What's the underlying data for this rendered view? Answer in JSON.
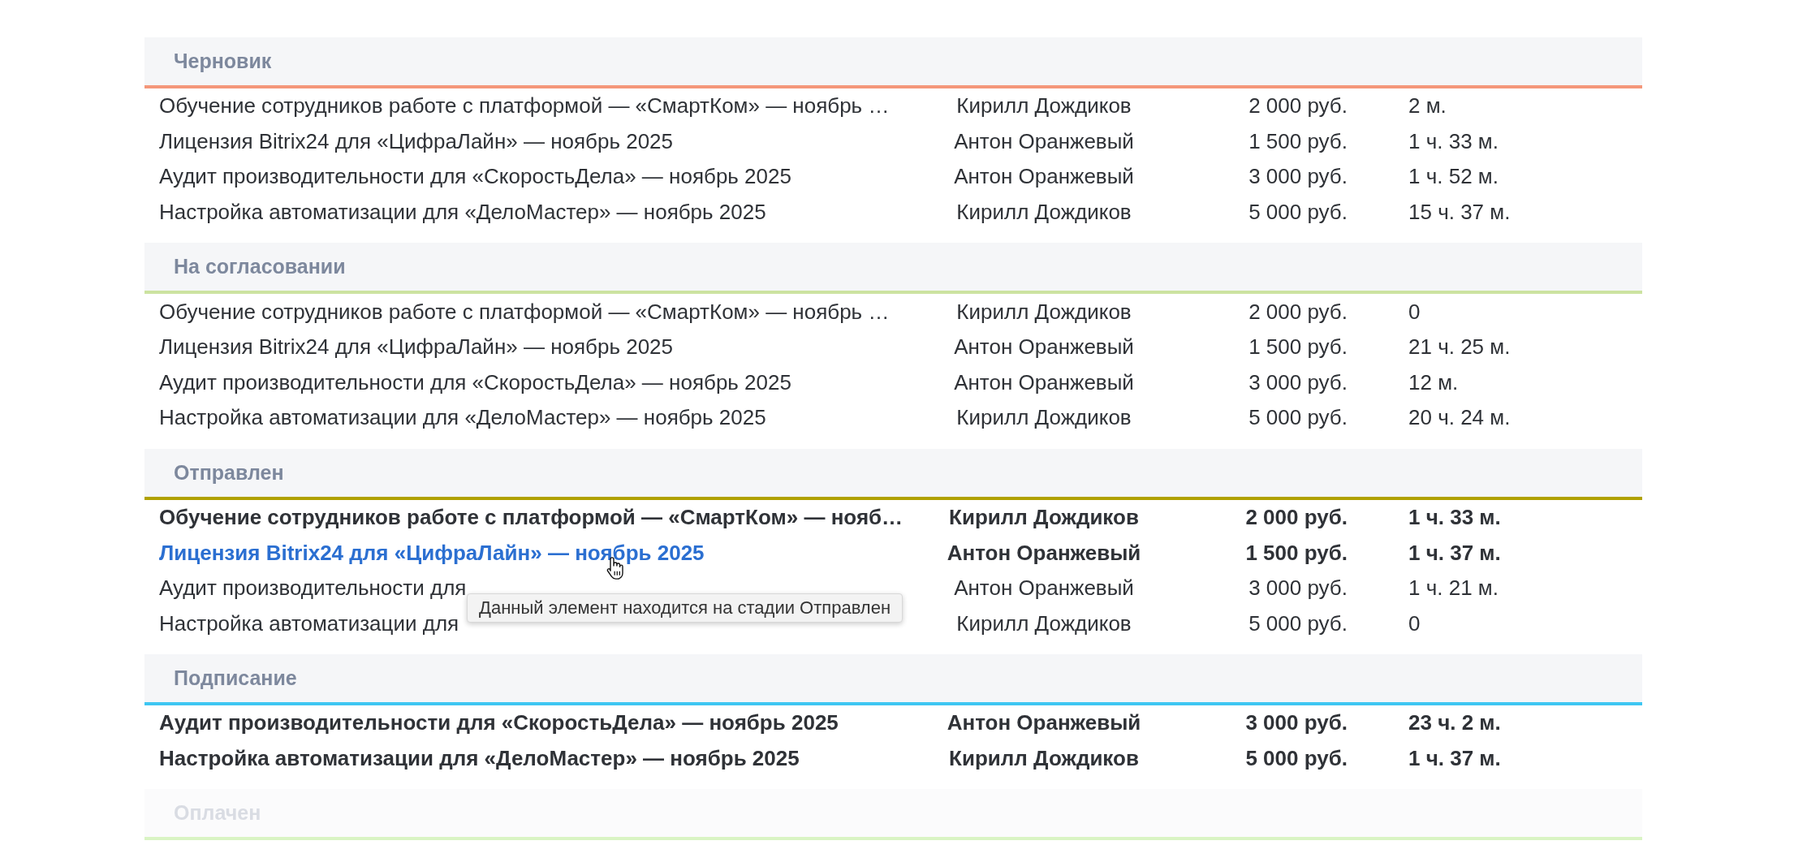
{
  "sections": [
    {
      "title": "Черновик",
      "color": "#f4977a",
      "faded": false,
      "rows": [
        {
          "title": "Обучение сотрудников работе с платформой — «СмартКом» — ноябрь …",
          "author": "Кирилл Дождиков",
          "sum": "2 000 руб.",
          "time": "2 м.",
          "bold": false,
          "hovered": false
        },
        {
          "title": "Лицензия Bitrix24 для «ЦифраЛайн» — ноябрь 2025",
          "author": "Антон Оранжевый",
          "sum": "1 500 руб.",
          "time": "1 ч. 33 м.",
          "bold": false,
          "hovered": false
        },
        {
          "title": "Аудит производительности для «СкоростьДела» — ноябрь 2025",
          "author": "Антон Оранжевый",
          "sum": "3 000 руб.",
          "time": "1 ч. 52 м.",
          "bold": false,
          "hovered": false
        },
        {
          "title": "Настройка автоматизации для «ДелоМастер» — ноябрь 2025",
          "author": "Кирилл Дождиков",
          "sum": "5 000 руб.",
          "time": "15 ч. 37 м.",
          "bold": false,
          "hovered": false
        }
      ]
    },
    {
      "title": "На согласовании",
      "color": "#cce3a0",
      "faded": false,
      "rows": [
        {
          "title": "Обучение сотрудников работе с платформой — «СмартКом» — ноябрь …",
          "author": "Кирилл Дождиков",
          "sum": "2 000 руб.",
          "time": "0",
          "bold": false,
          "hovered": false
        },
        {
          "title": "Лицензия Bitrix24 для «ЦифраЛайн» — ноябрь 2025",
          "author": "Антон Оранжевый",
          "sum": "1 500 руб.",
          "time": "21 ч. 25 м.",
          "bold": false,
          "hovered": false
        },
        {
          "title": "Аудит производительности для «СкоростьДела» — ноябрь 2025",
          "author": "Антон Оранжевый",
          "sum": "3 000 руб.",
          "time": "12 м.",
          "bold": false,
          "hovered": false
        },
        {
          "title": "Настройка автоматизации для «ДелоМастер» — ноябрь 2025",
          "author": "Кирилл Дождиков",
          "sum": "5 000 руб.",
          "time": "20 ч. 24 м.",
          "bold": false,
          "hovered": false
        }
      ]
    },
    {
      "title": "Отправлен",
      "color": "#b0a100",
      "faded": false,
      "rows": [
        {
          "title": "Обучение сотрудников работе с платформой — «СмартКом» — нояб…",
          "author": "Кирилл Дождиков",
          "sum": "2 000 руб.",
          "time": "1 ч. 33 м.",
          "bold": true,
          "hovered": false
        },
        {
          "title": "Лицензия Bitrix24 для «ЦифраЛайн» — ноябрь 2025",
          "author": "Антон Оранжевый",
          "sum": "1 500 руб.",
          "time": "1 ч. 37 м.",
          "bold": true,
          "hovered": true
        },
        {
          "title": "Аудит производительности для",
          "author": "Антон Оранжевый",
          "sum": "3 000 руб.",
          "time": "1 ч. 21 м.",
          "bold": false,
          "hovered": false
        },
        {
          "title": "Настройка автоматизации для",
          "author": "Кирилл Дождиков",
          "sum": "5 000 руб.",
          "time": "0",
          "bold": false,
          "hovered": false
        }
      ]
    },
    {
      "title": "Подписание",
      "color": "#3ec6f2",
      "faded": false,
      "rows": [
        {
          "title": "Аудит производительности для «СкоростьДела» — ноябрь 2025",
          "author": "Антон Оранжевый",
          "sum": "3 000 руб.",
          "time": "23 ч. 2 м.",
          "bold": true,
          "hovered": false
        },
        {
          "title": "Настройка автоматизации для «ДелоМастер» — ноябрь 2025",
          "author": "Кирилл Дождиков",
          "sum": "5 000 руб.",
          "time": "1 ч. 37 м.",
          "bold": true,
          "hovered": false
        }
      ]
    },
    {
      "title": "Оплачен",
      "color": "#d9f4c4",
      "faded": true
    }
  ],
  "tooltip": {
    "text": "Данный элемент находится на стадии Отправлен"
  }
}
